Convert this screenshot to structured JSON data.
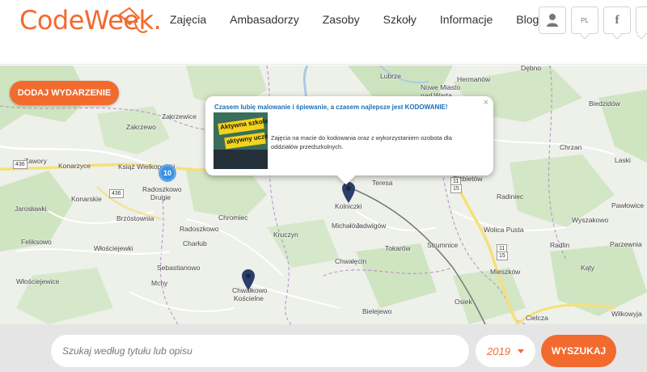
{
  "brand": {
    "logo_text": "CodeWeek.",
    "accent": "#f26a2e"
  },
  "nav": {
    "items": [
      "Zajęcia",
      "Ambasadorzy",
      "Zasoby",
      "Szkoły",
      "Informacje",
      "Blog"
    ]
  },
  "header_icons": {
    "user": "user-icon",
    "language": "PL",
    "facebook": "f"
  },
  "map": {
    "add_event_label": "DODAJ WYDARZENIE",
    "cluster_count": "10",
    "places": [
      "Lubrze",
      "Hermanów",
      "Nowe Miasto",
      "nad Wartą",
      "Zakrzewo",
      "Zakrzewice",
      "Biedzidów",
      "Zawory",
      "Konarzyce",
      "Książ Wielkopolski",
      "Radoszkowo",
      "Drugie",
      "Konarskie",
      "Jarosławki",
      "Brzóstownia",
      "Feliksowo",
      "Włościejewki",
      "Radoszkowo",
      "Charłub",
      "Chromiec",
      "Kruczyn",
      "Sebastianowo",
      "Mchy",
      "Chwałkowo",
      "Kościelne",
      "Włościejewice",
      "Kolniczki",
      "Teresa",
      "Michałów",
      "Jadwigów",
      "Tokarów",
      "Chwałęcin",
      "Bielejewo",
      "Strumnice",
      "Elżbietów",
      "Radiniec",
      "Chrzan",
      "Laski",
      "Pawłowice",
      "Wyszakowo",
      "Wolica Pusta",
      "Radlin",
      "Parzewnia",
      "Mieszków",
      "Kąty",
      "Osiek",
      "Cielcza",
      "Wilkowyja",
      "Dębno"
    ],
    "road_numbers": [
      "436",
      "436",
      "11",
      "15",
      "11",
      "15"
    ],
    "popup": {
      "title": "Czasem lubię malowanie i śpiewanie, a czasem najlepsze jest KODOWANIE!",
      "description": "Zajęcia na macie do kodowania oraz z wykorzystaniem ozobota dla oddziałów przedszkolnych.",
      "image_text_1": "Aktywna szkoła",
      "image_text_2": "aktywny uczeń",
      "close": "×"
    }
  },
  "search": {
    "placeholder": "Szukaj według tytułu lub opisu",
    "year": "2019",
    "button_label": "WYSZUKAJ"
  }
}
